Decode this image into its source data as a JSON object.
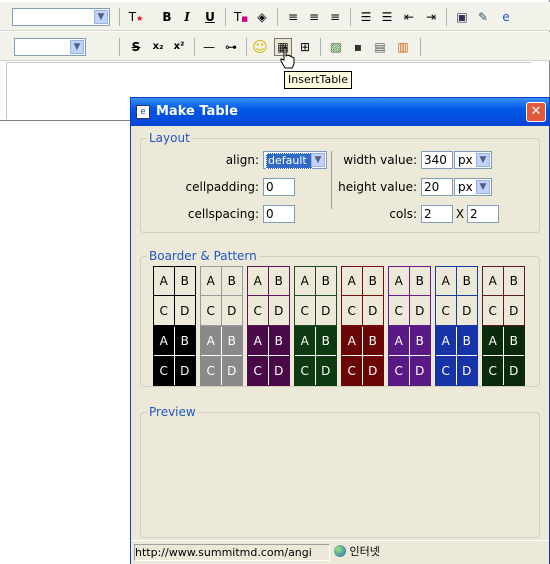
{
  "editor": {
    "tooltip": "InsertTable",
    "toolbar1": {
      "bold": "B",
      "italic": "I",
      "underline": "U"
    },
    "toolbar2": {
      "strike": "S",
      "subscript": "x₂",
      "superscript": "x²"
    }
  },
  "dialog": {
    "title": "Make Table",
    "close": "✕",
    "layout": {
      "legend": "Layout",
      "align_label": "align:",
      "align_value": "default",
      "cellpadding_label": "cellpadding:",
      "cellpadding_value": "0",
      "cellspacing_label": "cellspacing:",
      "cellspacing_value": "0",
      "width_label": "width value:",
      "width_value": "340",
      "width_unit": "px",
      "height_label": "height value:",
      "height_value": "20",
      "height_unit": "px",
      "cols_label": "cols:",
      "cols_value": "2",
      "rows_value": "2",
      "times": "X"
    },
    "border_pattern": {
      "legend": "Boarder & Pattern",
      "cell_letters": [
        "A",
        "B",
        "C",
        "D"
      ],
      "outline_colors": [
        "#000000",
        "#9a9a9a",
        "#5a1a5a",
        "#1e4a2a",
        "#7a0a0a",
        "#6a1a8a",
        "#1a3aa0",
        "#5a1a2a"
      ],
      "filled_colors": [
        "#000000",
        "#8a8a8a",
        "#4a0a4a",
        "#0e3a12",
        "#6a0606",
        "#5a1a86",
        "#1634a8",
        "#0a2a0a"
      ]
    },
    "preview": {
      "legend": "Preview"
    },
    "status": {
      "url": "http://www.summitmd.com/angi",
      "zone": "인터넷"
    }
  }
}
